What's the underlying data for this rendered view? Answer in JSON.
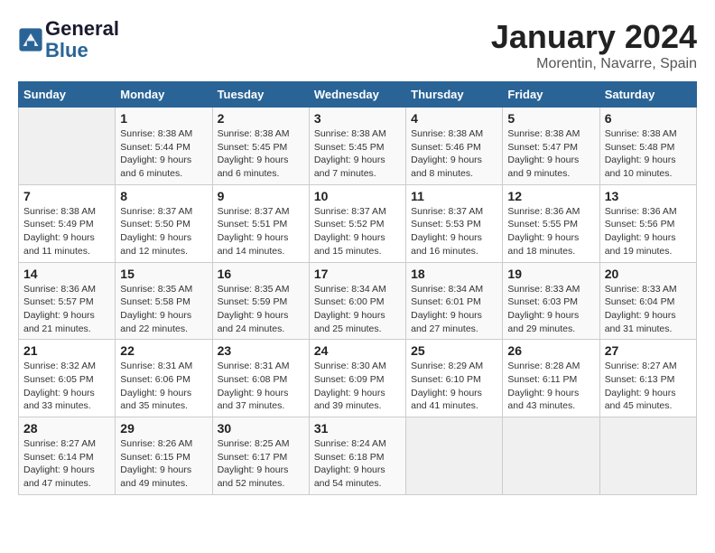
{
  "header": {
    "logo_line1": "General",
    "logo_line2": "Blue",
    "month": "January 2024",
    "location": "Morentin, Navarre, Spain"
  },
  "weekdays": [
    "Sunday",
    "Monday",
    "Tuesday",
    "Wednesday",
    "Thursday",
    "Friday",
    "Saturday"
  ],
  "weeks": [
    [
      {
        "day": "",
        "info": ""
      },
      {
        "day": "1",
        "info": "Sunrise: 8:38 AM\nSunset: 5:44 PM\nDaylight: 9 hours\nand 6 minutes."
      },
      {
        "day": "2",
        "info": "Sunrise: 8:38 AM\nSunset: 5:45 PM\nDaylight: 9 hours\nand 6 minutes."
      },
      {
        "day": "3",
        "info": "Sunrise: 8:38 AM\nSunset: 5:45 PM\nDaylight: 9 hours\nand 7 minutes."
      },
      {
        "day": "4",
        "info": "Sunrise: 8:38 AM\nSunset: 5:46 PM\nDaylight: 9 hours\nand 8 minutes."
      },
      {
        "day": "5",
        "info": "Sunrise: 8:38 AM\nSunset: 5:47 PM\nDaylight: 9 hours\nand 9 minutes."
      },
      {
        "day": "6",
        "info": "Sunrise: 8:38 AM\nSunset: 5:48 PM\nDaylight: 9 hours\nand 10 minutes."
      }
    ],
    [
      {
        "day": "7",
        "info": "Sunrise: 8:38 AM\nSunset: 5:49 PM\nDaylight: 9 hours\nand 11 minutes."
      },
      {
        "day": "8",
        "info": "Sunrise: 8:37 AM\nSunset: 5:50 PM\nDaylight: 9 hours\nand 12 minutes."
      },
      {
        "day": "9",
        "info": "Sunrise: 8:37 AM\nSunset: 5:51 PM\nDaylight: 9 hours\nand 14 minutes."
      },
      {
        "day": "10",
        "info": "Sunrise: 8:37 AM\nSunset: 5:52 PM\nDaylight: 9 hours\nand 15 minutes."
      },
      {
        "day": "11",
        "info": "Sunrise: 8:37 AM\nSunset: 5:53 PM\nDaylight: 9 hours\nand 16 minutes."
      },
      {
        "day": "12",
        "info": "Sunrise: 8:36 AM\nSunset: 5:55 PM\nDaylight: 9 hours\nand 18 minutes."
      },
      {
        "day": "13",
        "info": "Sunrise: 8:36 AM\nSunset: 5:56 PM\nDaylight: 9 hours\nand 19 minutes."
      }
    ],
    [
      {
        "day": "14",
        "info": "Sunrise: 8:36 AM\nSunset: 5:57 PM\nDaylight: 9 hours\nand 21 minutes."
      },
      {
        "day": "15",
        "info": "Sunrise: 8:35 AM\nSunset: 5:58 PM\nDaylight: 9 hours\nand 22 minutes."
      },
      {
        "day": "16",
        "info": "Sunrise: 8:35 AM\nSunset: 5:59 PM\nDaylight: 9 hours\nand 24 minutes."
      },
      {
        "day": "17",
        "info": "Sunrise: 8:34 AM\nSunset: 6:00 PM\nDaylight: 9 hours\nand 25 minutes."
      },
      {
        "day": "18",
        "info": "Sunrise: 8:34 AM\nSunset: 6:01 PM\nDaylight: 9 hours\nand 27 minutes."
      },
      {
        "day": "19",
        "info": "Sunrise: 8:33 AM\nSunset: 6:03 PM\nDaylight: 9 hours\nand 29 minutes."
      },
      {
        "day": "20",
        "info": "Sunrise: 8:33 AM\nSunset: 6:04 PM\nDaylight: 9 hours\nand 31 minutes."
      }
    ],
    [
      {
        "day": "21",
        "info": "Sunrise: 8:32 AM\nSunset: 6:05 PM\nDaylight: 9 hours\nand 33 minutes."
      },
      {
        "day": "22",
        "info": "Sunrise: 8:31 AM\nSunset: 6:06 PM\nDaylight: 9 hours\nand 35 minutes."
      },
      {
        "day": "23",
        "info": "Sunrise: 8:31 AM\nSunset: 6:08 PM\nDaylight: 9 hours\nand 37 minutes."
      },
      {
        "day": "24",
        "info": "Sunrise: 8:30 AM\nSunset: 6:09 PM\nDaylight: 9 hours\nand 39 minutes."
      },
      {
        "day": "25",
        "info": "Sunrise: 8:29 AM\nSunset: 6:10 PM\nDaylight: 9 hours\nand 41 minutes."
      },
      {
        "day": "26",
        "info": "Sunrise: 8:28 AM\nSunset: 6:11 PM\nDaylight: 9 hours\nand 43 minutes."
      },
      {
        "day": "27",
        "info": "Sunrise: 8:27 AM\nSunset: 6:13 PM\nDaylight: 9 hours\nand 45 minutes."
      }
    ],
    [
      {
        "day": "28",
        "info": "Sunrise: 8:27 AM\nSunset: 6:14 PM\nDaylight: 9 hours\nand 47 minutes."
      },
      {
        "day": "29",
        "info": "Sunrise: 8:26 AM\nSunset: 6:15 PM\nDaylight: 9 hours\nand 49 minutes."
      },
      {
        "day": "30",
        "info": "Sunrise: 8:25 AM\nSunset: 6:17 PM\nDaylight: 9 hours\nand 52 minutes."
      },
      {
        "day": "31",
        "info": "Sunrise: 8:24 AM\nSunset: 6:18 PM\nDaylight: 9 hours\nand 54 minutes."
      },
      {
        "day": "",
        "info": ""
      },
      {
        "day": "",
        "info": ""
      },
      {
        "day": "",
        "info": ""
      }
    ]
  ]
}
